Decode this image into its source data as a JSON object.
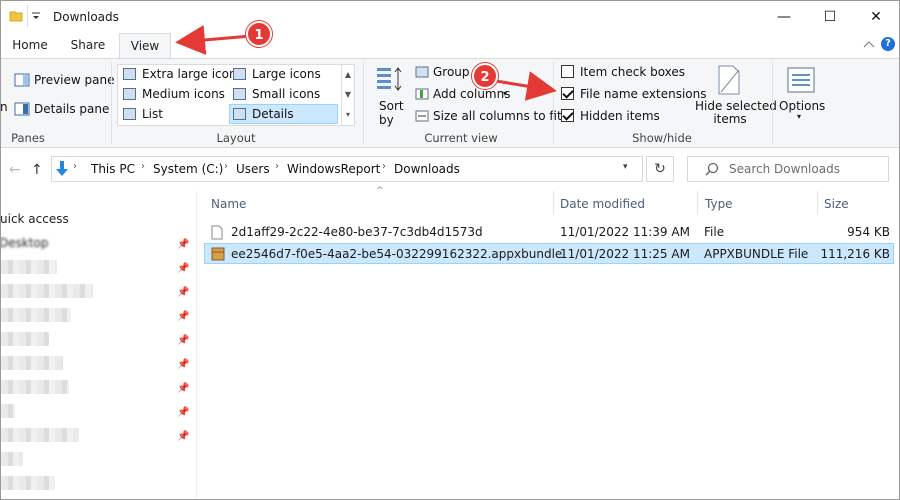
{
  "window": {
    "title": "Downloads",
    "controls": {
      "minimize": "—",
      "maximize": "☐",
      "close": "✕"
    }
  },
  "ribbon_tabs": [
    "Home",
    "Share",
    "View"
  ],
  "ribbon": {
    "panes": {
      "preview_pane": "Preview pane",
      "details_pane": "Details pane",
      "group_label": "Panes",
      "nav_pane_fragment": "n"
    },
    "layout": {
      "items": [
        "Extra large icons",
        "Large icons",
        "Medium icons",
        "Small icons",
        "List",
        "Details"
      ],
      "selected": "Details",
      "group_label": "Layout"
    },
    "current_view": {
      "sort_by": "Sort",
      "sort_by_2": "by",
      "group_by": "Group b",
      "add_columns": "Add columns",
      "size_all_columns": "Size all columns to fit",
      "group_label": "Current view"
    },
    "show_hide": {
      "item_check_boxes": "Item check boxes",
      "file_name_extensions": "File name extensions",
      "hidden_items": "Hidden items",
      "hide_selected_1": "Hide selected",
      "hide_selected_2": "items",
      "group_label": "Show/hide",
      "checks": {
        "item_check_boxes": false,
        "file_name_extensions": true,
        "hidden_items": true
      }
    },
    "options": {
      "label": "Options"
    }
  },
  "address": {
    "crumbs": [
      "This PC",
      "System (C:)",
      "Users",
      "WindowsReport",
      "Downloads"
    ],
    "search_placeholder": "Search Downloads"
  },
  "nav_pane": {
    "quick_access": "uick access",
    "desktop": "Desktop"
  },
  "columns": [
    "Name",
    "Date modified",
    "Type",
    "Size"
  ],
  "files": [
    {
      "name": "2d1aff29-2c22-4e80-be37-7c3db4d1573d",
      "date": "11/01/2022 11:39 AM",
      "type": "File",
      "size": "954 KB"
    },
    {
      "name": "ee2546d7-f0e5-4aa2-be54-032299162322.appxbundle",
      "date": "11/01/2022 11:25 AM",
      "type": "APPXBUNDLE File",
      "size": "111,216 KB"
    }
  ],
  "annotations": [
    "1",
    "2"
  ],
  "colors": {
    "accent": "#0078d7",
    "selection": "#cce8ff",
    "annotation": "#e53935"
  }
}
